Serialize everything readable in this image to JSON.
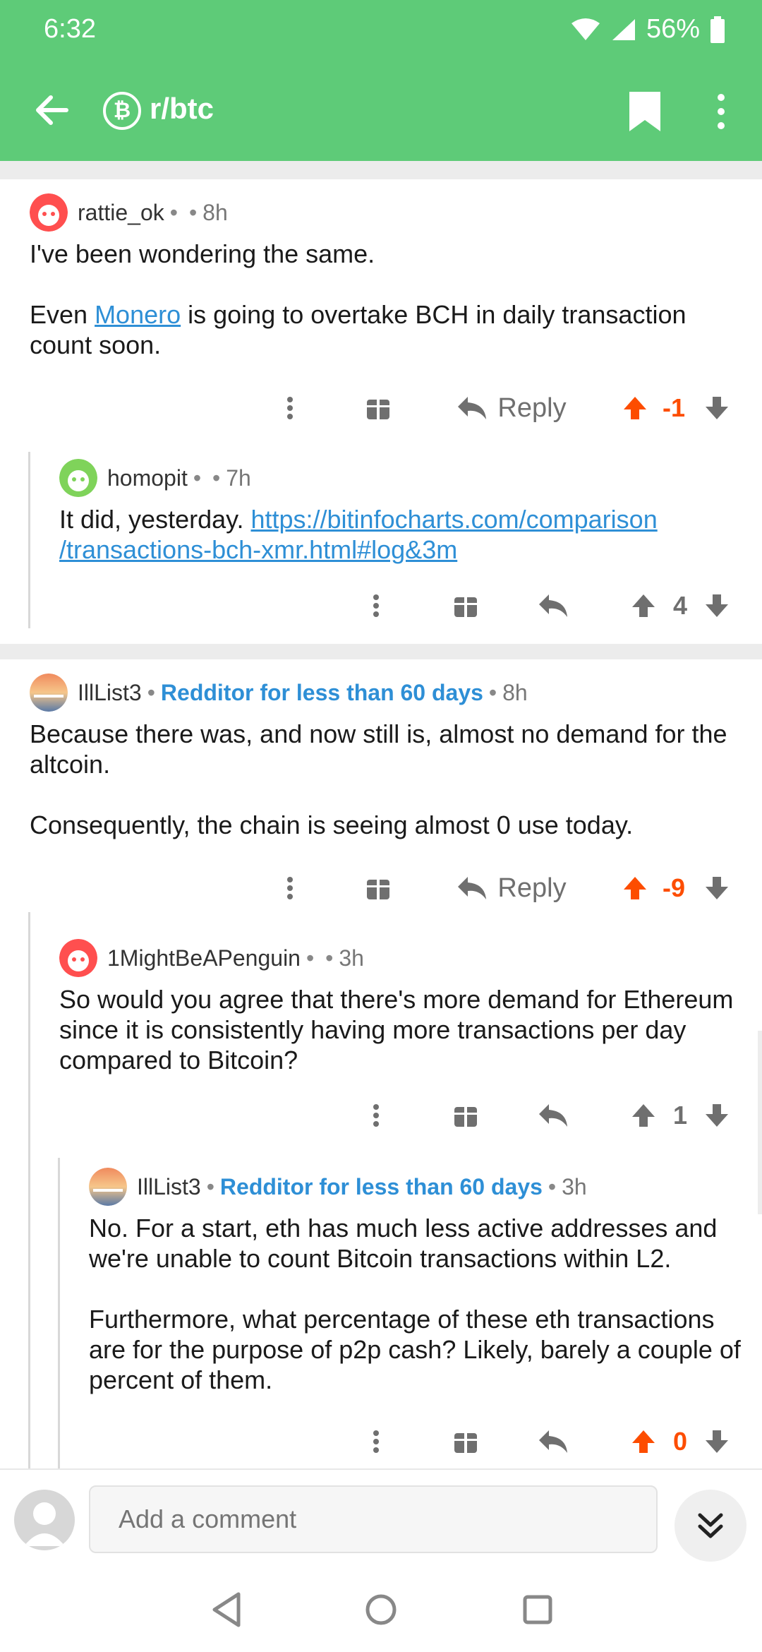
{
  "status_bar": {
    "time": "6:32",
    "battery": "56%"
  },
  "toolbar": {
    "subreddit": "r/btc",
    "sub_icon": "bitcoin-icon"
  },
  "comments": [
    {
      "author": "rattie_ok",
      "flair": "",
      "time": "8h",
      "paragraphs": [
        "I've been wondering the same."
      ],
      "p2_prefix": "Even ",
      "p2_link": "Monero",
      "p2_suffix": " is going to overtake BCH in daily transaction count soon.",
      "reply_label": "Reply",
      "score": "-1"
    },
    {
      "author": "homopit",
      "flair": "",
      "time": "7h",
      "text_prefix": "It did, yesterday. ",
      "link": "https://bitinfocharts.com/comparison/transactions-bch-xmr.html#log&3m",
      "link_line1": "https://bitinfocharts.com/comparison",
      "link_line2": "/transactions-bch-xmr.html#log&3m",
      "score": "4"
    },
    {
      "author": "IllList3",
      "flair": "Redditor for less than 60 days",
      "time": "8h",
      "paragraphs": [
        "Because there was, and now still is, almost no demand for the altcoin.",
        "Consequently, the chain is seeing almost 0 use today."
      ],
      "reply_label": "Reply",
      "score": "-9"
    },
    {
      "author": "1MightBeAPenguin",
      "flair": "",
      "time": "3h",
      "paragraphs": [
        "So would you agree that there's more demand for Ethereum since it is consistently having more transactions per day compared to Bitcoin?"
      ],
      "score": "1"
    },
    {
      "author": "IllList3",
      "flair": "Redditor for less than 60 days",
      "time": "3h",
      "paragraphs": [
        "No.  For a start, eth has much less active addresses and we're unable to count Bitcoin transactions within L2.",
        "Furthermore, what percentage of these eth transactions are for the purpose of p2p cash?  Likely, barely a couple of percent of them."
      ],
      "score": "0"
    }
  ],
  "composer": {
    "placeholder": "Add a comment"
  },
  "colors": {
    "header": "#5ecb78",
    "upvote": "#fd4d00",
    "link": "#2e8fd6",
    "neutral": "#6f6f6f"
  }
}
